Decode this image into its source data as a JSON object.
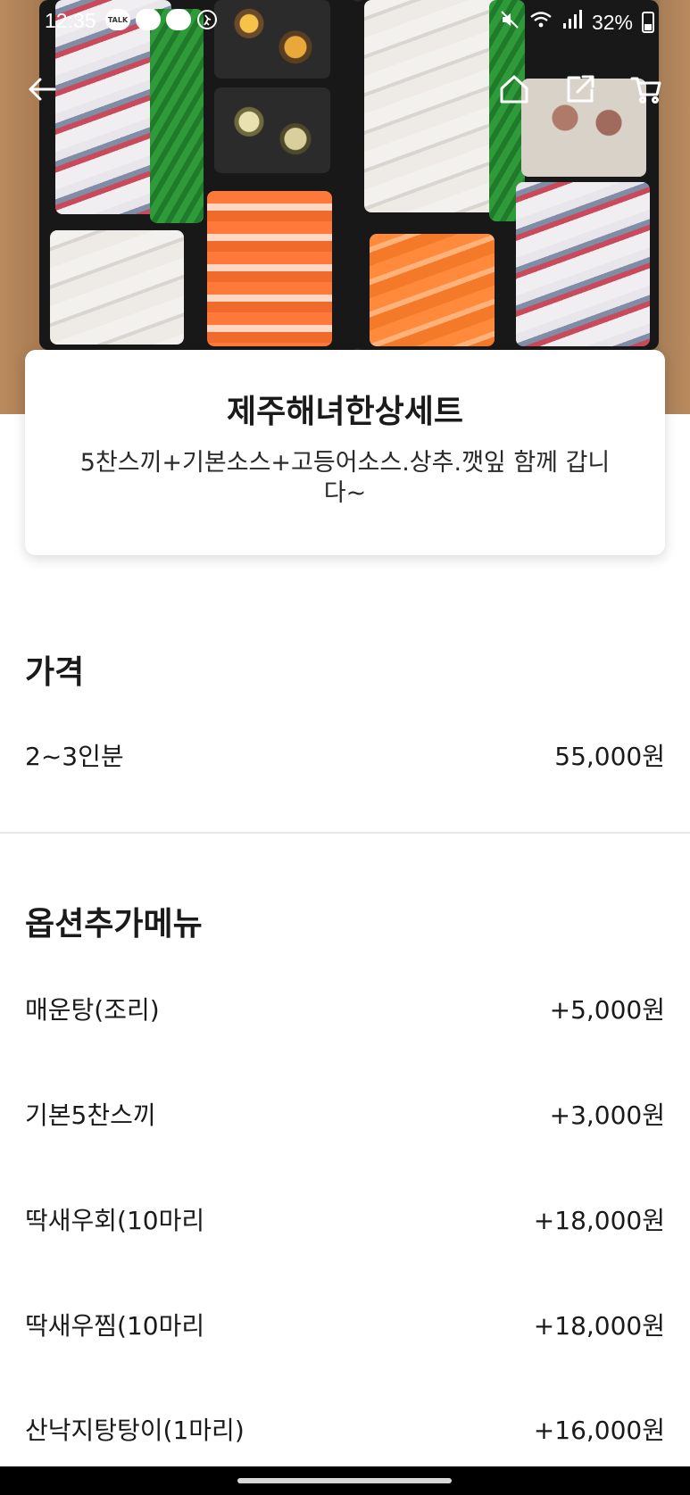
{
  "status_bar": {
    "time": "12:35",
    "battery": "32%",
    "left_icons": [
      "talk-icon",
      "chat-bubble-icon",
      "chat-bubble-icon",
      "running-icon"
    ],
    "talk_label": "TALK",
    "right_icons": [
      "mute-icon",
      "wifi-icon",
      "signal-icon",
      "battery-icon"
    ]
  },
  "nav": {
    "back": "back-arrow-icon",
    "home": "home-icon",
    "share": "share-icon",
    "cart": "cart-icon"
  },
  "product": {
    "name": "제주해녀한상세트",
    "description": "5찬스끼+기본소스+고등어소스.상추.깻잎 함께 갑니다~"
  },
  "price_section": {
    "title": "가격",
    "items": [
      {
        "label": "2~3인분",
        "value": "55,000원"
      }
    ]
  },
  "options_section": {
    "title": "옵션추가메뉴",
    "items": [
      {
        "label": "매운탕(조리)",
        "value": "+5,000원"
      },
      {
        "label": "기본5찬스끼",
        "value": "+3,000원"
      },
      {
        "label": "딱새우회(10마리",
        "value": "+18,000원"
      },
      {
        "label": "딱새우찜(10마리",
        "value": "+18,000원"
      },
      {
        "label": "산낙지탕탕이(1마리)",
        "value": "+16,000원"
      }
    ]
  },
  "colors": {
    "text": "#1a1a1a",
    "divider": "#e7e7e7",
    "card_bg": "#ffffff"
  }
}
